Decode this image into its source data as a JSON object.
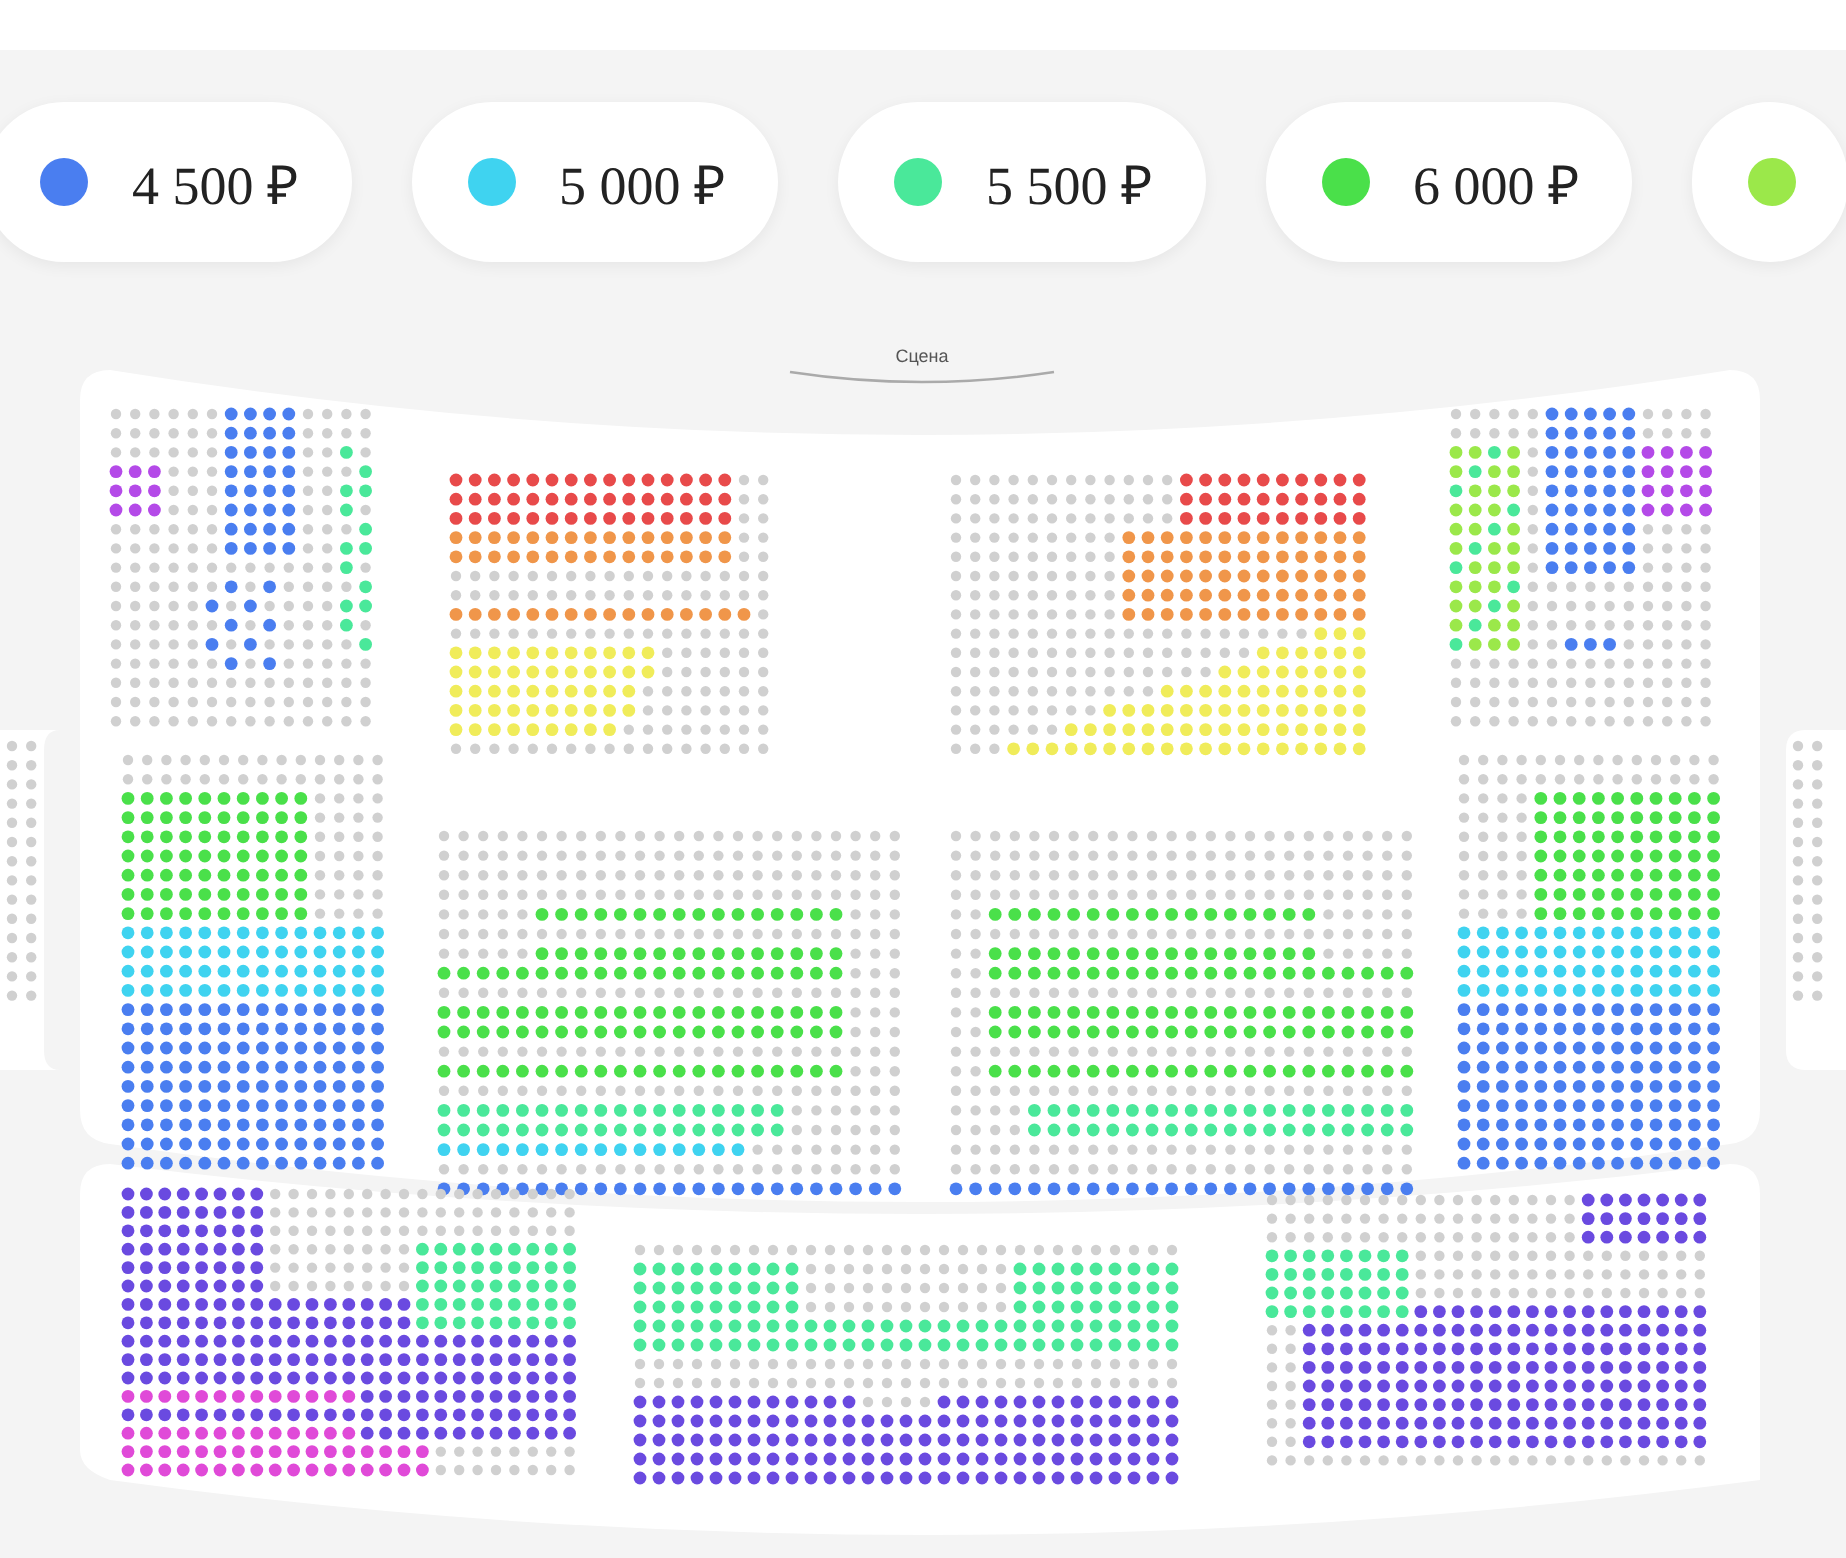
{
  "legend": [
    {
      "price": "4 500 ₽",
      "color": "#4a7ef0"
    },
    {
      "price": "5 000 ₽",
      "color": "#3fd3f0"
    },
    {
      "price": "5 500 ₽",
      "color": "#4ae89a"
    },
    {
      "price": "6 000 ₽",
      "color": "#4ae04a"
    },
    {
      "color": "#9be84a"
    }
  ],
  "stage": {
    "label": "Сцена"
  }
}
